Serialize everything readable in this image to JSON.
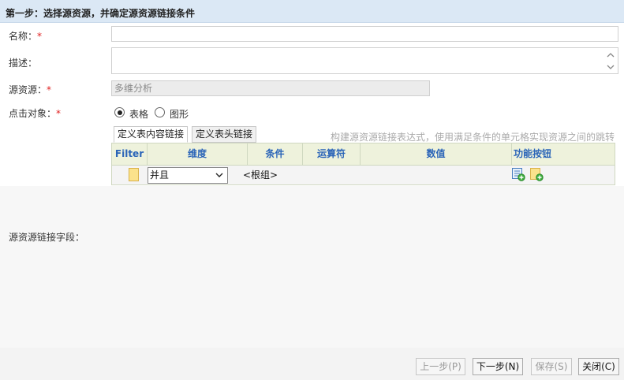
{
  "header": {
    "title": "第一步：选择源资源，并确定源资源链接条件"
  },
  "form": {
    "name_label": "名称：",
    "desc_label": "描述：",
    "source_label": "源资源：",
    "source_value": "多维分析",
    "click_label": "点击对象：",
    "required_mark": "*",
    "radio_table": "表格",
    "radio_chart": "图形",
    "link_fields_label": "源资源链接字段："
  },
  "tabs": {
    "content_link": "定义表内容链接",
    "header_link": "定义表头链接"
  },
  "hint": "构建源资源链接表达式，使用满足条件的单元格实现资源之间的跳转",
  "grid": {
    "columns": [
      "Filter",
      "维度",
      "条件",
      "运算符",
      "数值",
      "功能按钮"
    ],
    "row": {
      "logic": "并且",
      "root": "<根组>"
    }
  },
  "footer": {
    "prev": "上一步(P)",
    "next": "下一步(N)",
    "save": "保存(S)",
    "close": "关闭(C)"
  },
  "colors": {
    "header_bg": "#dbe8f5",
    "grid_header_text": "#2a64b8",
    "required": "#e02020"
  }
}
